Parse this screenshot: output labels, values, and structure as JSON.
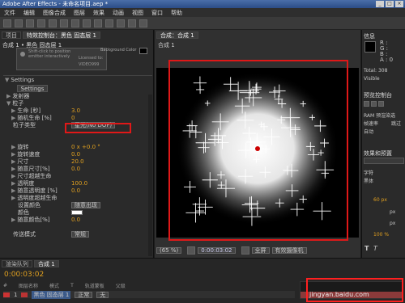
{
  "app": {
    "title": "Adobe After Effects - 未命名项目.aep *",
    "window_controls": [
      "_",
      "□",
      "×"
    ]
  },
  "menu": [
    "文件",
    "编辑",
    "图像合成",
    "图层",
    "效果",
    "动画",
    "视图",
    "窗口",
    "帮助"
  ],
  "left_panel": {
    "tabs": [
      "项目",
      "特效控制台：黑色 固态层 1"
    ],
    "breadcrumb": "合成 1 • 黑色 固态层 1",
    "hint": "Shift-click to position emitter interactively",
    "licensed": "Licensed to:",
    "license_id": "VIDEO999",
    "bg_label": "Background Color",
    "settings": "Settings",
    "settings_btn": "Settings",
    "params": [
      {
        "label": "发射器",
        "value": "",
        "ind": 1,
        "tri": "▶"
      },
      {
        "label": "粒子",
        "value": "",
        "ind": 1,
        "tri": "▼"
      },
      {
        "label": "生命 [秒]",
        "value": "3.0",
        "ind": 2,
        "tri": "▶"
      },
      {
        "label": "随机生命 [%]",
        "value": "0",
        "ind": 2,
        "tri": "▶"
      },
      {
        "label": "粒子类型",
        "value": "星光(No DOF)",
        "ind": 2,
        "tri": "",
        "dropdown": true
      },
      {
        "label": "",
        "value": "",
        "ind": 2,
        "tri": ""
      },
      {
        "label": "",
        "value": "",
        "ind": 2,
        "tri": ""
      },
      {
        "label": "旋转",
        "value": "0 x +0.0 °",
        "ind": 2,
        "tri": "▶"
      },
      {
        "label": "旋转速度",
        "value": "0.0",
        "ind": 2,
        "tri": "▶"
      },
      {
        "label": "尺寸",
        "value": "20.0",
        "ind": 2,
        "tri": "▶"
      },
      {
        "label": "随意尺寸[%]",
        "value": "0.0",
        "ind": 2,
        "tri": "▶"
      },
      {
        "label": "尺寸超越生命",
        "value": "",
        "ind": 2,
        "tri": "▶"
      },
      {
        "label": "透明度",
        "value": "100.0",
        "ind": 2,
        "tri": "▶"
      },
      {
        "label": "随意透明度 [%]",
        "value": "0.0",
        "ind": 2,
        "tri": "▶"
      },
      {
        "label": "透明度超越生命",
        "value": "",
        "ind": 2,
        "tri": "▶"
      },
      {
        "label": "设置颜色",
        "value": "随意出现",
        "ind": 3,
        "tri": "",
        "dropdown": true
      },
      {
        "label": "颜色",
        "value": "",
        "ind": 3,
        "tri": "",
        "swatch": true
      },
      {
        "label": "随意颜色[%]",
        "value": "0.0",
        "ind": 2,
        "tri": "▶"
      },
      {
        "label": "",
        "value": "",
        "ind": 2,
        "tri": ""
      },
      {
        "label": "传送模式",
        "value": "常规",
        "ind": 2,
        "tri": "",
        "dropdown": true
      },
      {
        "label": "",
        "value": "",
        "ind": 2,
        "tri": ""
      }
    ]
  },
  "comp": {
    "tab": "合成：合成 1",
    "sub_tab": "合成 1",
    "zoom": "(65 %)",
    "timecode": "0:00:03:02",
    "view": "全屏",
    "view2": "有效摄像机"
  },
  "right_panel": {
    "info_tab": "信息",
    "rgb": [
      "R :",
      "G :",
      "B :",
      "A : 0"
    ],
    "total": "Total: 308",
    "visible": "Visible",
    "preview_tab": "预览控制台",
    "ram": "RAM 预渲染选",
    "fps": "帧速率",
    "skip": "跳过",
    "auto": "自动",
    "effects_tab": "效果和预置",
    "font_tab": "字符",
    "font": "黑体",
    "size": "60 px",
    "px": "px",
    "lead": "px",
    "pct": "100 %",
    "tt": "T",
    "ts": "T"
  },
  "timeline": {
    "tabs": [
      "渲染队列",
      "合成 1"
    ],
    "timecode": "0:00:03:02",
    "layer_name": "黑色 固态层 1",
    "layer_num": "1",
    "mode": "正常",
    "parent": "无",
    "cols": [
      "#",
      "图层名称",
      "模式",
      "T",
      "轨道蒙板",
      "父级"
    ]
  },
  "watermark": "jingyan.baidu.com"
}
